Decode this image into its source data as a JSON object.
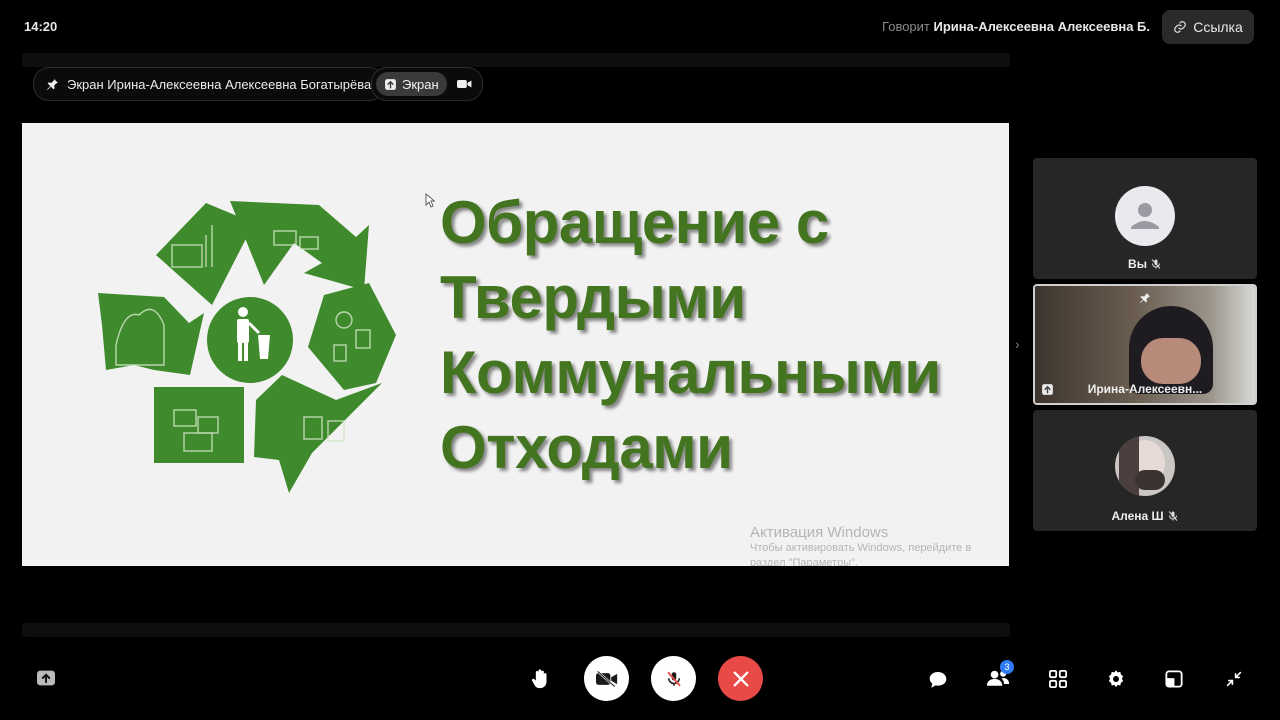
{
  "header": {
    "time": "14:20",
    "speaking_label": "Говорит",
    "speaking_name": "Ирина-Алексеевна Алексеевна Б.",
    "link_label": "Ссылка"
  },
  "stage": {
    "pinned_label": "Экран Ирина-Алексеевна Алексеевна Богатырёва",
    "screen_chip_label": "Экран"
  },
  "slide": {
    "title_lines": [
      "Обращение с",
      "Твердыми",
      "Коммунальными",
      "Отходами"
    ],
    "watermark_title": "Активация Windows",
    "watermark_text": "Чтобы активировать Windows, перейдите в раздел \"Параметры\"."
  },
  "participants": [
    {
      "name": "Вы",
      "muted": true
    },
    {
      "name": "Ирина-Алексеевн...",
      "pinned": true,
      "sharing": true
    },
    {
      "name": "Алена Ш",
      "muted": true
    }
  ],
  "toolbar": {
    "participants_badge": "3"
  },
  "colors": {
    "slide_green": "#43741f",
    "recycle_green": "#3f8a2c",
    "end_call_red": "#e84a48",
    "badge_blue": "#2f7df6"
  }
}
